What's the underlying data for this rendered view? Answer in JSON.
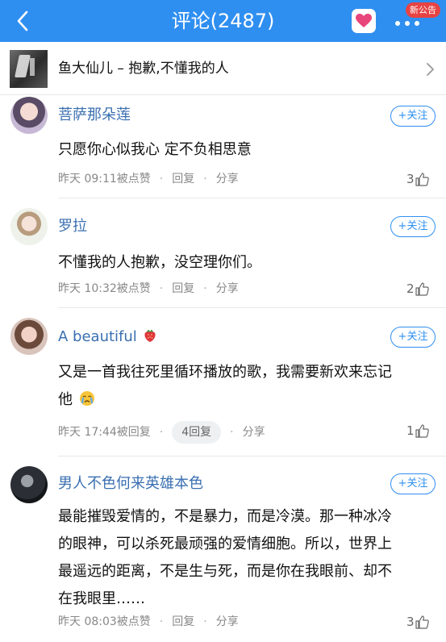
{
  "header": {
    "title": "评论(2487)",
    "badge": "新公告",
    "accent": "#2f8ff0"
  },
  "song": {
    "text": "鱼大仙儿 – 抱歉,不懂我的人"
  },
  "comments": [
    {
      "user": "菩萨那朵莲",
      "follow": "+关注",
      "text": "只愿你心似我心 定不负相思意",
      "time": "昨天 09:11",
      "action": "被点赞",
      "reply": "回复",
      "share": "分享",
      "likes": "3"
    },
    {
      "user": "罗拉",
      "follow": "+关注",
      "text": "不懂我的人抱歉，没空理你们。",
      "time": "昨天 10:32",
      "action": "被点赞",
      "reply": "回复",
      "share": "分享",
      "likes": "2"
    },
    {
      "user": "A beautiful",
      "user_emoji": "strawberry-emoji",
      "follow": "+关注",
      "text_line1": "又是一首我往死里循环播放的歌，我需要新欢来忘记",
      "text_line2": "他",
      "text_emoji": "crying-face-emoji",
      "time": "昨天 17:44",
      "action": "被回复",
      "reply_count": "4回复",
      "share": "分享",
      "likes": "1"
    },
    {
      "user": "男人不色何来英雄本色",
      "follow": "+关注",
      "text_lines": [
        "最能摧毁爱情的，不是暴力，而是冷漠。那一种冰冷",
        "的眼神，可以杀死最顽强的爱情细胞。所以，世界上",
        "最遥远的距离，不是生与死，而是你在我眼前、却不",
        "在我眼里……"
      ],
      "time": "昨天 08:03",
      "action": "被点赞",
      "reply": "回复",
      "share": "分享",
      "likes": "3"
    }
  ]
}
